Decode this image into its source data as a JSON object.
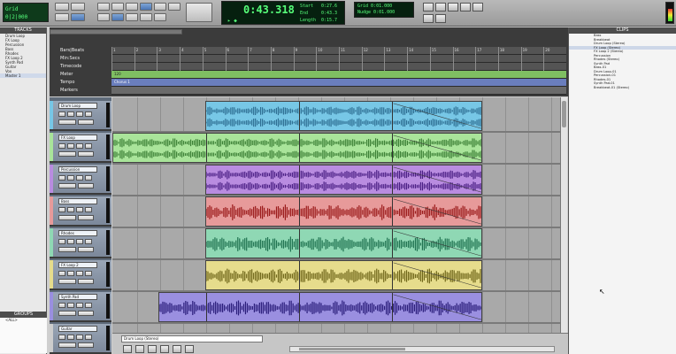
{
  "toolbar": {
    "mini_lcd_top": "Grid",
    "mini_lcd_bottom": "0|2|000",
    "counter_main": "0:43.318",
    "counter_start_label": "Start",
    "counter_end_label": "End",
    "counter_length_label": "Length",
    "counter_start": "0:27.6",
    "counter_end": "0:43.3",
    "counter_length": "0:15.7",
    "lcd2_line1": "Grid  0:01.000",
    "lcd2_line2": "Nudge 0:01.000",
    "colors": {
      "lcd_green": "#57ff7a",
      "lcd_bg": "#06200f"
    }
  },
  "tracks_panel": {
    "title": "TRACKS",
    "items": [
      "Drum Loop",
      "FX Loop",
      "Percussion",
      "Bass",
      "Rhodes",
      "FX Loop 2",
      "Synth Pad",
      "Guitar",
      "Vox",
      "Master 1"
    ]
  },
  "groups_panel": {
    "title": "GROUPS",
    "items": [
      "<ALL>"
    ]
  },
  "rulers": {
    "labels": [
      "Bars|Beats",
      "Min:Secs",
      "Timecode",
      "Meter",
      "Tempo",
      "Markers"
    ],
    "bar_numbers": [
      "1",
      "2",
      "3",
      "4",
      "5",
      "6",
      "7",
      "8",
      "9",
      "10",
      "11",
      "12",
      "13",
      "14",
      "15",
      "16",
      "17",
      "18",
      "19",
      "20"
    ],
    "marker_text": "Chorus 1",
    "tempo_text": "120"
  },
  "tracks": [
    {
      "name": "Drum Loop",
      "color": "#77c7e6",
      "wave": "#2e6e92"
    },
    {
      "name": "FX Loop",
      "color": "#a9e49a",
      "wave": "#3b7f35"
    },
    {
      "name": "Percussion",
      "color": "#b98ce0",
      "wave": "#4a1f84"
    },
    {
      "name": "Bass",
      "color": "#e79a9a",
      "wave": "#9a1a1a"
    },
    {
      "name": "Rhodes",
      "color": "#8fd8b4",
      "wave": "#1f7250"
    },
    {
      "name": "FX Loop 2",
      "color": "#e6dc8c",
      "wave": "#6e6518"
    },
    {
      "name": "Synth Pad",
      "color": "#9a8fe0",
      "wave": "#2a1d7a"
    },
    {
      "name": "Guitar",
      "color": "#cccccc",
      "wave": "#555555"
    }
  ],
  "clips_panel": {
    "title": "CLIPS",
    "items": [
      "Bass",
      "Breakbeat",
      "Drum Loop (Stereo)",
      "FX Loop (Stereo)",
      "FX Loop 2 (Stereo)",
      "Percussion",
      "Rhodes (Stereo)",
      "Synth Pad",
      "Bass-01",
      "Drum Loop-01",
      "Percussion-01",
      "Rhodes-01",
      "Synth Pad-01",
      "Breakbeat-01 (Stereo)"
    ]
  },
  "edit_bottom": {
    "field": "Drum Loop (Stereo)"
  }
}
